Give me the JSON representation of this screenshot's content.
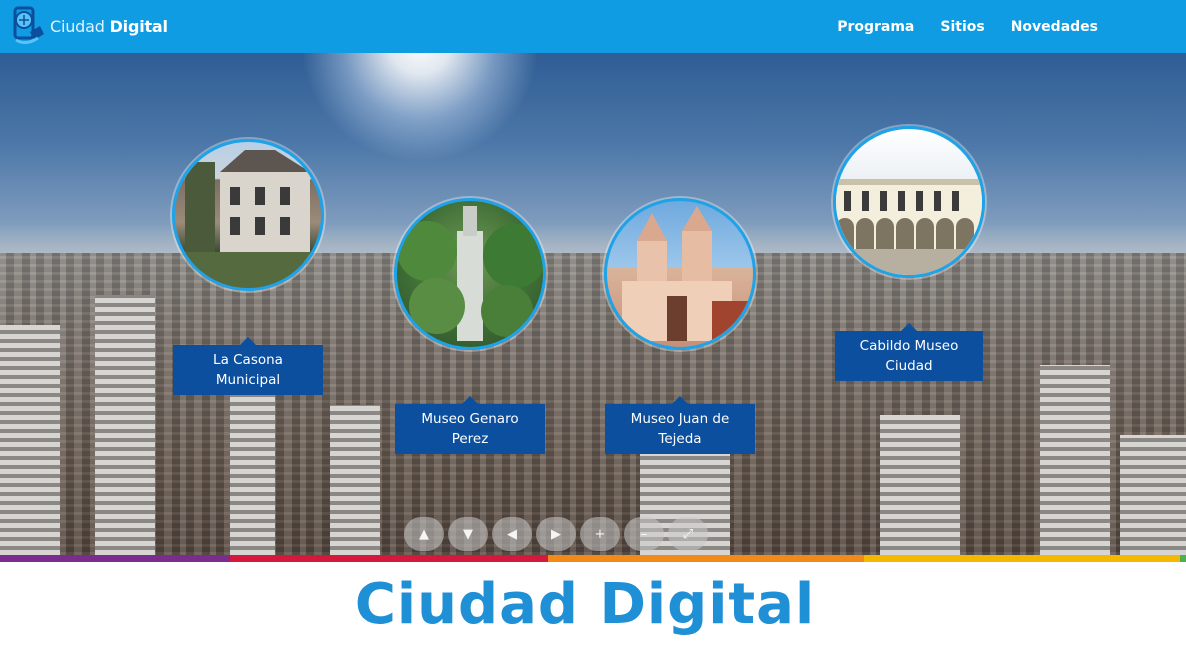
{
  "header": {
    "brand_light": "Ciudad",
    "brand_bold": "Digital",
    "nav": [
      {
        "label": "Programa"
      },
      {
        "label": "Sitios"
      },
      {
        "label": "Novedades"
      }
    ]
  },
  "hotspots": [
    {
      "label": "La Casona Municipal",
      "icon": "building-photo"
    },
    {
      "label": "Museo Genaro Perez",
      "icon": "building-photo"
    },
    {
      "label": "Museo Juan de Tejeda",
      "icon": "church-photo"
    },
    {
      "label": "Cabildo Museo Ciudad",
      "icon": "colonnade-photo"
    }
  ],
  "controls": [
    {
      "name": "up",
      "glyph": "▲"
    },
    {
      "name": "down",
      "glyph": "▼"
    },
    {
      "name": "left",
      "glyph": "◀"
    },
    {
      "name": "right",
      "glyph": "▶"
    },
    {
      "name": "zoom-in",
      "glyph": "+"
    },
    {
      "name": "zoom-out",
      "glyph": "–"
    },
    {
      "name": "fullscreen",
      "glyph": "⤢"
    }
  ],
  "stripe_colors": [
    "#7b2d8e",
    "#d5183b",
    "#f28a1a",
    "#f5b800",
    "#4caf50"
  ],
  "footer_title": "Ciudad Digital",
  "colors": {
    "header": "#109ce3",
    "label_bg": "#0b4f9e",
    "title": "#1f8fd6"
  }
}
